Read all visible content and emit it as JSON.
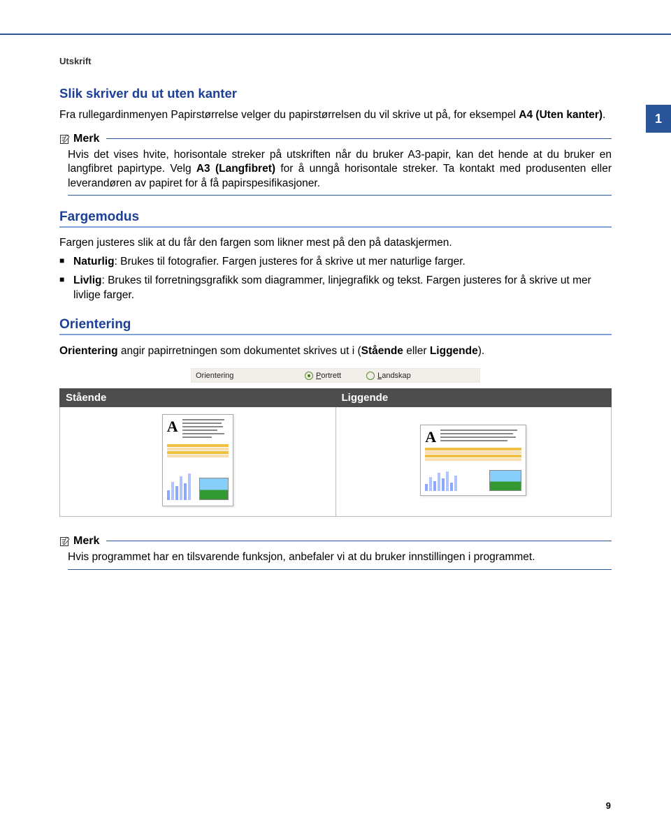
{
  "section_label": "Utskrift",
  "chapter_number": "1",
  "page_number": "9",
  "borderless": {
    "heading": "Slik skriver du ut uten kanter",
    "body_prefix": "Fra rullegardinmenyen Papirstørrelse velger du papirstørrelsen du vil skrive ut på, for eksempel ",
    "body_option": "A4 (Uten kanter)",
    "body_suffix": "."
  },
  "note1": {
    "label": "Merk",
    "text_pre": "Hvis det vises hvite, horisontale streker på utskriften når du bruker A3-papir, kan det hende at du bruker en langfibret papirtype. Velg ",
    "text_bold": "A3 (Langfibret)",
    "text_post": " for å unngå horisontale streker. Ta kontakt med produsenten eller leverandøren av papiret for å få papirspesifikasjoner."
  },
  "fargemodus": {
    "heading": "Fargemodus",
    "intro": "Fargen justeres slik at du får den fargen som likner mest på den på dataskjermen.",
    "items": [
      {
        "label": "Naturlig",
        "text": ": Brukes til fotografier. Fargen justeres for å skrive ut mer naturlige farger."
      },
      {
        "label": "Livlig",
        "text": ": Brukes til forretningsgrafikk som diagrammer, linjegrafikk og tekst. Fargen justeres for å skrive ut mer livlige farger."
      }
    ]
  },
  "orientering": {
    "heading": "Orientering",
    "sentence_pre": "Orientering",
    "sentence_mid": " angir papirretningen som dokumentet skrives ut i (",
    "sentence_opt1": "Stående",
    "sentence_or": " eller ",
    "sentence_opt2": "Liggende",
    "sentence_post": ").",
    "radio_label": "Orientering",
    "radio_opt1": "Portrett",
    "radio_opt2": "Landskap",
    "col1": "Stående",
    "col2": "Liggende"
  },
  "note2": {
    "label": "Merk",
    "text": "Hvis programmet har en tilsvarende funksjon, anbefaler vi at du bruker innstillingen i programmet."
  }
}
